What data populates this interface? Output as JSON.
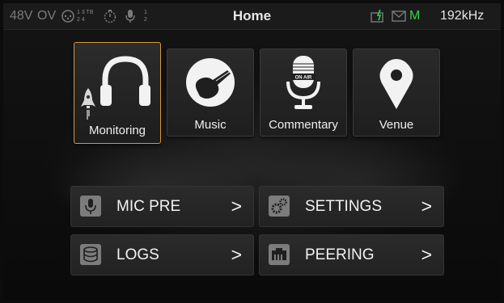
{
  "status_bar": {
    "phantom": "48V",
    "overvoltage": "OV",
    "matrix_top": "1 3 TB",
    "matrix_bottom": "2 4",
    "mic_top": "1",
    "mic_bottom": "2",
    "title": "Home",
    "mode": "M",
    "sample_rate": "192kHz",
    "icons": [
      "xlr-connector-icon",
      "timer-icon",
      "microphone-icon",
      "battery-charging-icon",
      "mail-icon"
    ]
  },
  "tiles": [
    {
      "label": "Monitoring",
      "icon": "headphones-icon",
      "active": true
    },
    {
      "label": "Music",
      "icon": "guitar-icon",
      "active": false
    },
    {
      "label": "Commentary",
      "icon": "on-air-microphone-icon",
      "active": false
    },
    {
      "label": "Venue",
      "icon": "location-pin-icon",
      "active": false
    }
  ],
  "on_air_text": "ON AIR",
  "menu": [
    {
      "label": "MIC PRE",
      "icon": "microphone-icon",
      "chevron": ">"
    },
    {
      "label": "SETTINGS",
      "icon": "gears-icon",
      "chevron": ">"
    },
    {
      "label": "LOGS",
      "icon": "database-icon",
      "chevron": ">"
    },
    {
      "label": "PEERING",
      "icon": "network-icon",
      "chevron": ">"
    }
  ],
  "colors": {
    "accent_border": "#d39a3a",
    "status_green": "#35d14a",
    "icon_grey": "#7c7c7c"
  }
}
